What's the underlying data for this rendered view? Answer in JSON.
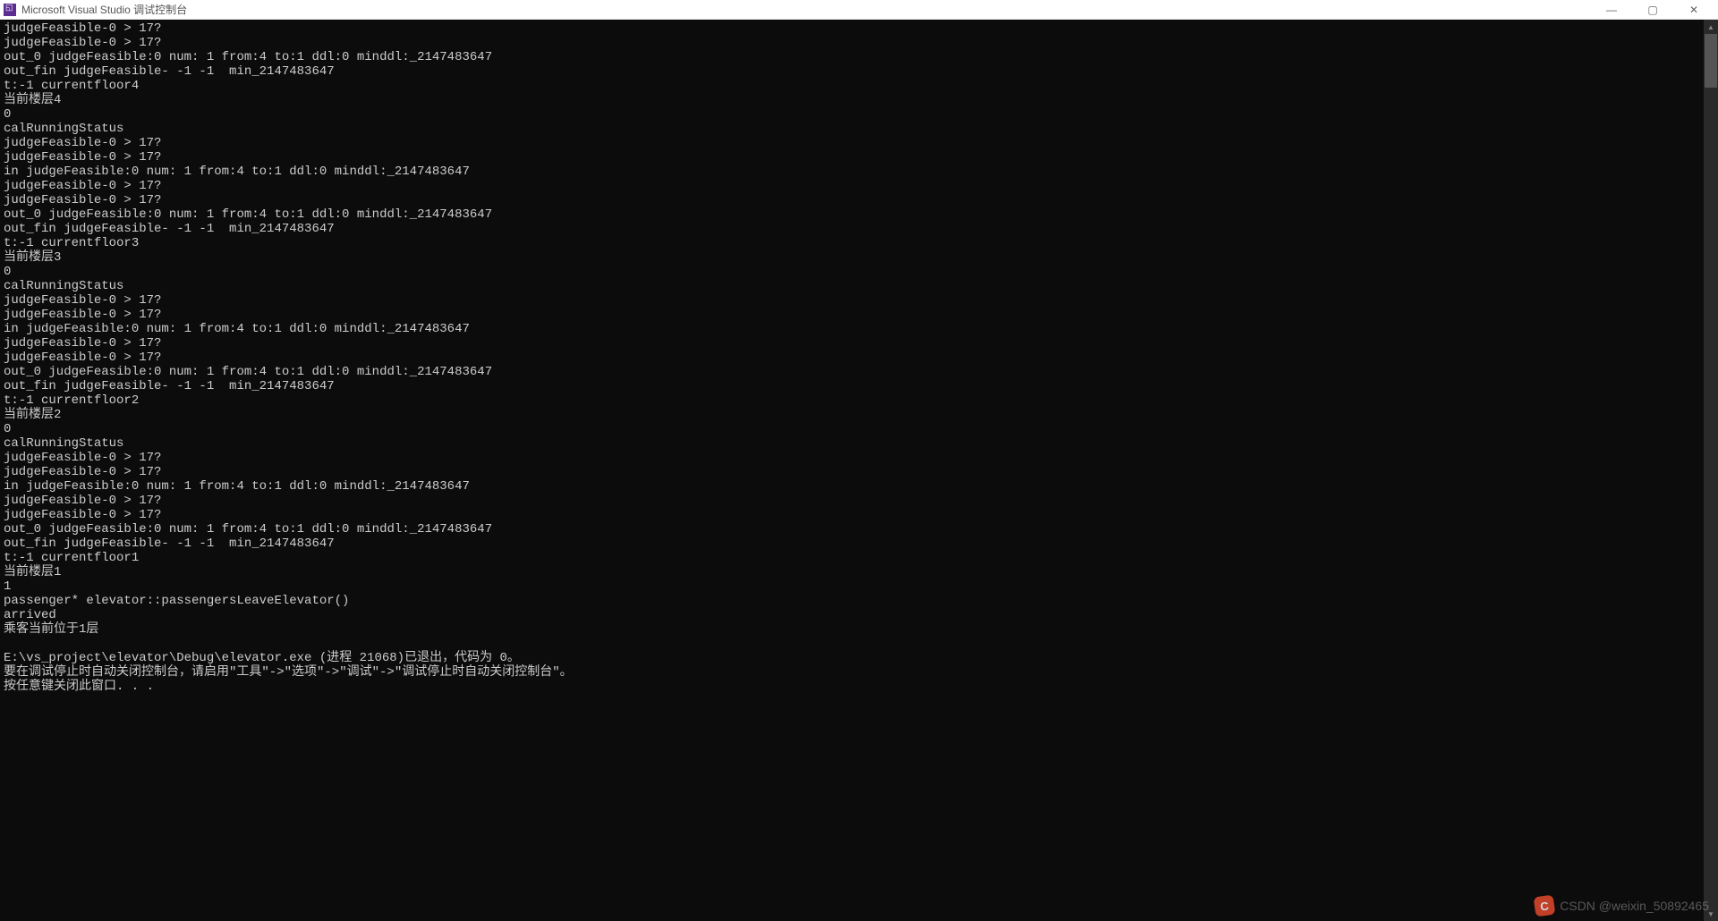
{
  "window": {
    "title": "Microsoft Visual Studio 调试控制台"
  },
  "console_lines": [
    "judgeFeasible-0 > 17?",
    "judgeFeasible-0 > 17?",
    "out_0 judgeFeasible:0 num: 1 from:4 to:1 ddl:0 minddl:_2147483647",
    "out_fin judgeFeasible- -1 -1  min_2147483647",
    "t:-1 currentfloor4",
    "当前楼层4",
    "0",
    "calRunningStatus",
    "judgeFeasible-0 > 17?",
    "judgeFeasible-0 > 17?",
    "in judgeFeasible:0 num: 1 from:4 to:1 ddl:0 minddl:_2147483647",
    "judgeFeasible-0 > 17?",
    "judgeFeasible-0 > 17?",
    "out_0 judgeFeasible:0 num: 1 from:4 to:1 ddl:0 minddl:_2147483647",
    "out_fin judgeFeasible- -1 -1  min_2147483647",
    "t:-1 currentfloor3",
    "当前楼层3",
    "0",
    "calRunningStatus",
    "judgeFeasible-0 > 17?",
    "judgeFeasible-0 > 17?",
    "in judgeFeasible:0 num: 1 from:4 to:1 ddl:0 minddl:_2147483647",
    "judgeFeasible-0 > 17?",
    "judgeFeasible-0 > 17?",
    "out_0 judgeFeasible:0 num: 1 from:4 to:1 ddl:0 minddl:_2147483647",
    "out_fin judgeFeasible- -1 -1  min_2147483647",
    "t:-1 currentfloor2",
    "当前楼层2",
    "0",
    "calRunningStatus",
    "judgeFeasible-0 > 17?",
    "judgeFeasible-0 > 17?",
    "in judgeFeasible:0 num: 1 from:4 to:1 ddl:0 minddl:_2147483647",
    "judgeFeasible-0 > 17?",
    "judgeFeasible-0 > 17?",
    "out_0 judgeFeasible:0 num: 1 from:4 to:1 ddl:0 minddl:_2147483647",
    "out_fin judgeFeasible- -1 -1  min_2147483647",
    "t:-1 currentfloor1",
    "当前楼层1",
    "1",
    "passenger* elevator::passengersLeaveElevator()",
    "arrived",
    "乘客当前位于1层",
    "",
    "E:\\vs_project\\elevator\\Debug\\elevator.exe (进程 21068)已退出，代码为 0。",
    "要在调试停止时自动关闭控制台，请启用\"工具\"->\"选项\"->\"调试\"->\"调试停止时自动关闭控制台\"。",
    "按任意键关闭此窗口. . ."
  ],
  "watermark": {
    "icon_letter": "C",
    "text": "CSDN @weixin_50892465"
  },
  "controls": {
    "minimize": "—",
    "maximize": "▢",
    "close": "✕"
  }
}
